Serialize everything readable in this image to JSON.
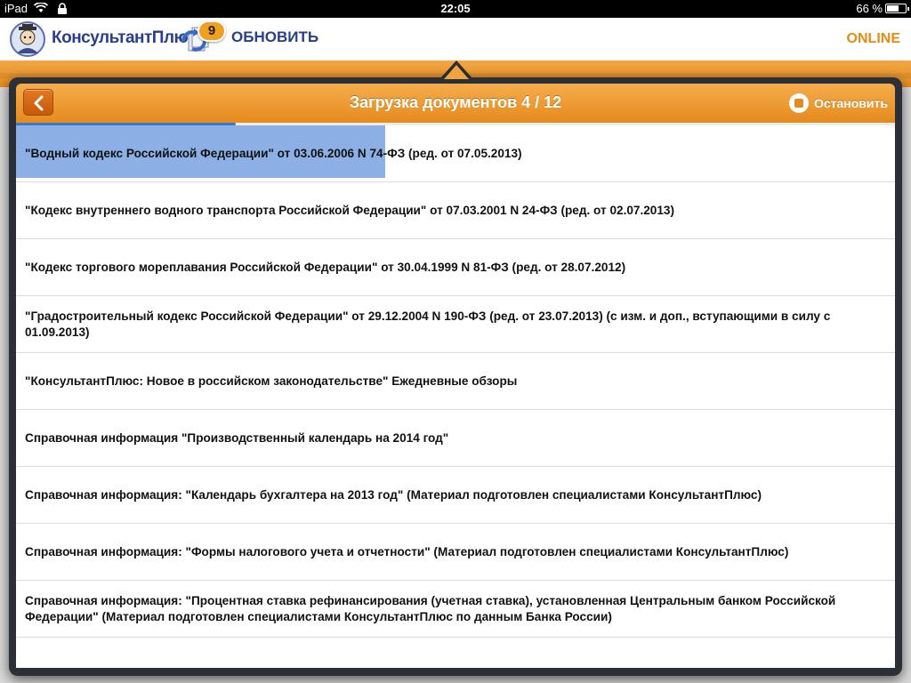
{
  "status_bar": {
    "device": "iPad",
    "time": "22:05",
    "battery_percent": "66 %",
    "battery_level": 0.66
  },
  "header": {
    "logo_text": "КонсультантПлюс",
    "update_count": "9",
    "update_label": "ОБНОВИТЬ",
    "mode_label": "ONLINE"
  },
  "popover": {
    "title": "Загрузка документов 4 / 12",
    "stop_label": "Остановить",
    "progress": 0.25,
    "first_item_progress": 0.42
  },
  "documents": [
    "\"Водный кодекс Российской Федерации\" от 03.06.2006 N 74-ФЗ (ред. от 07.05.2013)",
    "\"Кодекс внутреннего водного транспорта Российской Федерации\" от 07.03.2001 N 24-ФЗ (ред. от 02.07.2013)",
    "\"Кодекс торгового мореплавания Российской Федерации\" от 30.04.1999 N 81-ФЗ (ред. от 28.07.2012)",
    "\"Градостроительный кодекс Российской Федерации\" от 29.12.2004 N 190-ФЗ (ред. от 23.07.2013) (с изм. и доп., вступающими в силу с 01.09.2013)",
    "\"КонсультантПлюс: Новое в российском законодательстве\" Ежедневные обзоры",
    "Справочная информация \"Производственный календарь на 2014 год\"",
    "Справочная информация: \"Календарь бухгалтера на 2013 год\" (Материал подготовлен специалистами КонсультантПлюс)",
    "Справочная информация: \"Формы налогового учета и отчетности\" (Материал подготовлен специалистами КонсультантПлюс)",
    "Справочная информация: \"Процентная ставка рефинансирования (учетная ставка), установленная Центральным банком Российской Федерации\" (Материал подготовлен специалистами КонсультантПлюс по данным Банка России)"
  ],
  "colors": {
    "accent_orange": "#e88a12",
    "brand_blue": "#2a3f8c",
    "progress_blue": "#3b78c8",
    "highlight_blue": "#8cb0e6"
  }
}
